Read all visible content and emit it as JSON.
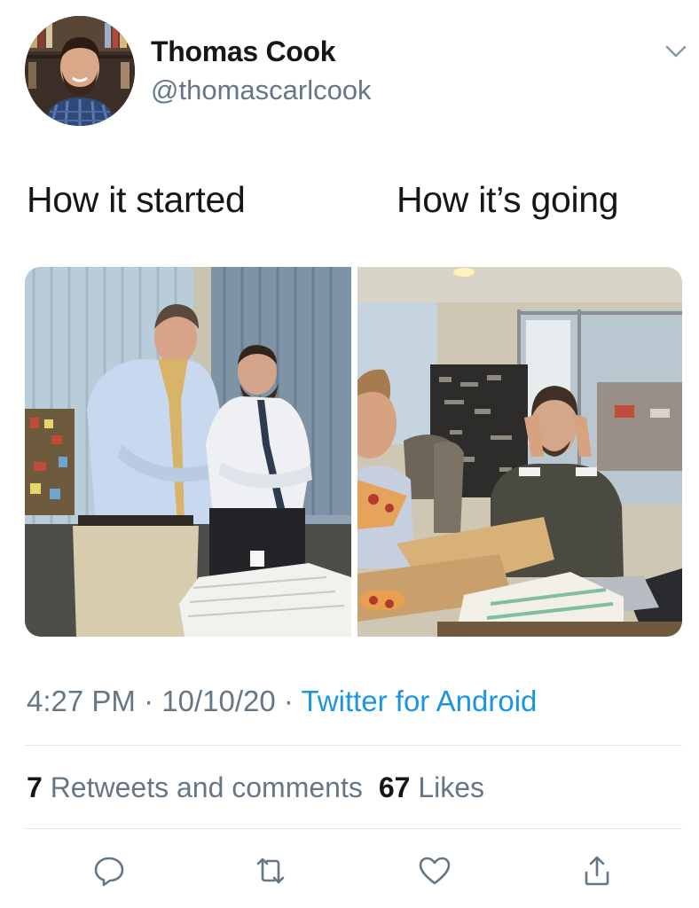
{
  "author": {
    "name": "Thomas Cook",
    "handle": "@thomascarlcook"
  },
  "tweet": {
    "caption_left": "How it started",
    "caption_right": "How it’s going"
  },
  "meta": {
    "time": "4:27 PM",
    "separator": " · ",
    "date": "10/10/20",
    "source": "Twitter for Android"
  },
  "stats": {
    "retweets_count": "7",
    "retweets_label": " Retweets and comments",
    "likes_count": "67",
    "likes_label": " Likes"
  },
  "icons": {
    "menu": "chevron-down-icon",
    "reply": "reply-icon",
    "retweet": "retweet-icon",
    "like": "heart-icon",
    "share": "share-icon"
  },
  "colors": {
    "text_primary": "#14171a",
    "text_secondary": "#657786",
    "link": "#1b95e0",
    "divider": "#e1e8ed"
  }
}
